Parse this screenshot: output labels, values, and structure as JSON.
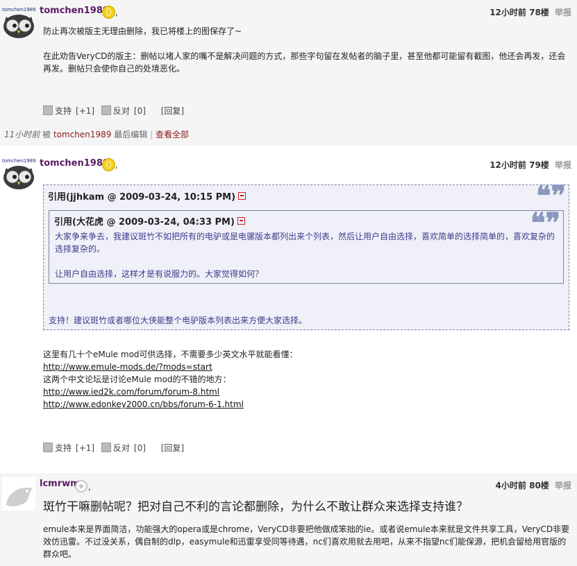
{
  "posts": [
    {
      "user": "tomchen1989",
      "time": "12小时前",
      "floor": "78楼",
      "report": "举报",
      "paragraphs": [
        "防止再次被版主无理由删除，我已将楼上的图保存了~",
        "在此劝告VeryCD的版主：删帖以堵人家的嘴不是解决问题的方式，那些字句留在发帖者的脑子里，甚至他都可能留有截图，他还会再发，还会再发。删帖只会使你自己的处境恶化。"
      ],
      "support": "支持",
      "support_count": "[+1]",
      "oppose": "反对",
      "oppose_count": "[0]",
      "reply": "[回复]",
      "edit": {
        "time": "11小时前",
        "by": "被",
        "editor": "tomchen1989",
        "suffix": "最后编辑",
        "sep": "|",
        "view_all": "查看全部"
      }
    },
    {
      "user": "tomchen1989",
      "time": "12小时前",
      "floor": "79楼",
      "report": "举报",
      "quote_outer_title": "引用(jjhkam @ 2009-03-24, 10:15 PM)",
      "quote_inner_title": "引用(大花虎 @ 2009-03-24, 04:33 PM)",
      "quote_inner_text_1": "大家争来争去，我建议斑竹不如把所有的电驴或是电骡版本都列出来个列表，然后让用户自由选择，喜欢简单的选择简单的，喜欢复杂的选择复杂的。",
      "quote_inner_text_2": "让用户自由选择，这样才是有说服力的。大家觉得如何？",
      "quote_outer_text": "支持！建议斑竹或者哪位大侠能整个电驴版本列表出来方便大家选择。",
      "lines": [
        "这里有几十个eMule mod可供选择，不需要多少英文水平就能看懂：",
        "http://www.emule-mods.de/?mods=start",
        "这两个中文论坛是讨论eMule mod的不错的地方：",
        "http://www.ied2k.com/forum/forum-8.html",
        "http://www.edonkey2000.cn/bbs/forum-6-1.html"
      ],
      "support": "支持",
      "support_count": "[+1]",
      "oppose": "反对",
      "oppose_count": "[0]",
      "reply": "[回复]"
    },
    {
      "user": "lcmrwm",
      "time": "4小时前",
      "floor": "80楼",
      "report": "举报",
      "title": "斑竹干嘛删帖呢？把对自己不利的言论都删除，为什么不敢让群众来选择支持谁？",
      "body": "emule本来是界面简洁，功能强大的opera或是chrome，VeryCD非要把他做成笨拙的ie。或者说emule本来就是文件共享工具，VeryCD非要效仿迅雷。不过没关系，偶自制的dlp，easymule和迅雷享受同等待遇，nc们喜欢用就去用吧，从来不指望nc们能保源，把机会留给用官版的群众吧。"
    }
  ],
  "comma": ","
}
